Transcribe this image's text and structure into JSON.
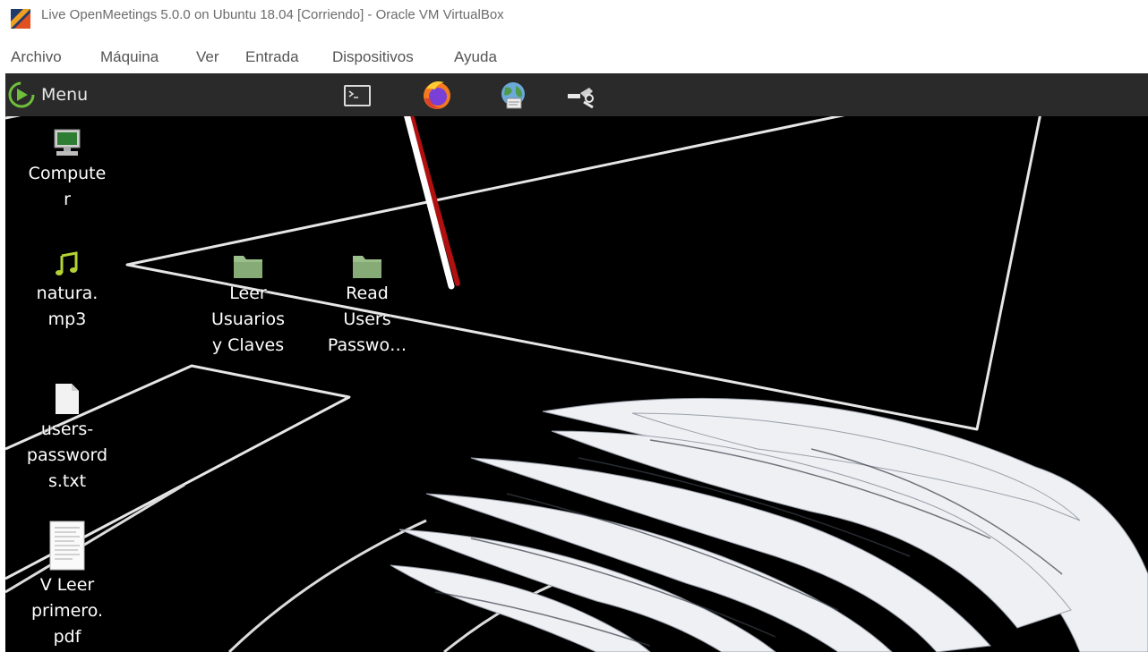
{
  "window": {
    "title": "Live OpenMeetings 5.0.0 on Ubuntu 18.04 [Corriendo] - Oracle VM VirtualBox"
  },
  "menubar": {
    "items": [
      "Archivo",
      "Máquina",
      "Ver",
      "Entrada",
      "Dispositivos",
      "Ayuda"
    ]
  },
  "panel": {
    "menu_label": "Menu",
    "launchers": [
      "terminal-icon",
      "firefox-icon",
      "network-globe-icon",
      "settings-tools-icon"
    ]
  },
  "desktop": {
    "icons": [
      {
        "name": "computer",
        "lines": [
          "Compute",
          "r"
        ],
        "icon": "computer-icon"
      },
      {
        "name": "natura-mp3",
        "lines": [
          "natura.",
          "mp3"
        ],
        "icon": "music-file-icon"
      },
      {
        "name": "leer-usuarios",
        "lines": [
          "Leer",
          "Usuarios",
          "y Claves"
        ],
        "icon": "folder-icon"
      },
      {
        "name": "read-users",
        "lines": [
          "Read",
          "Users",
          "Passwo…"
        ],
        "icon": "folder-icon"
      },
      {
        "name": "users-passwords-txt",
        "lines": [
          "users-",
          "password",
          "s.txt"
        ],
        "icon": "text-file-icon"
      },
      {
        "name": "v-leer-primero-pdf",
        "lines": [
          "V Leer",
          "primero.",
          "pdf"
        ],
        "icon": "pdf-file-icon"
      }
    ]
  },
  "colors": {
    "panel": "#2a2a2a",
    "desktop_bg": "#000000",
    "folder": "#9bbf8a",
    "accent_arrow": "#ffffff",
    "arrow_shadow": "#b01010"
  }
}
